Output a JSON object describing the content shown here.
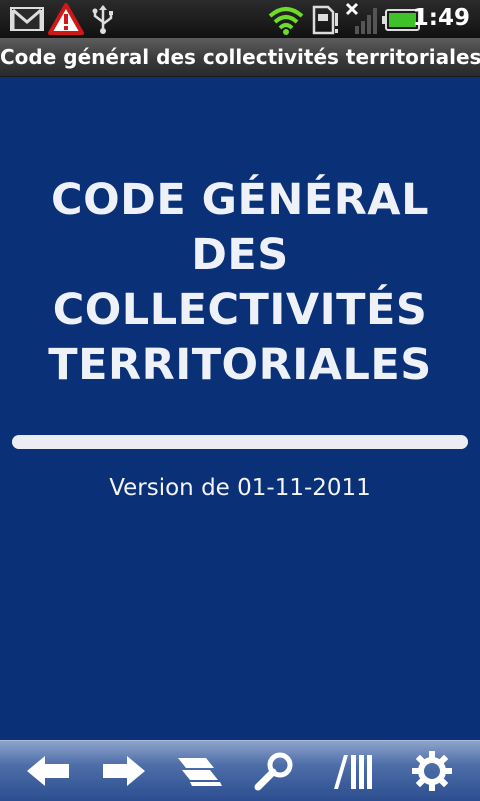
{
  "status_bar": {
    "time": "1:49",
    "icons": [
      "gmail-icon",
      "warning-icon",
      "usb-icon",
      "wifi-icon",
      "sim-card-icon",
      "signal-icon",
      "battery-icon"
    ]
  },
  "app": {
    "title": "Code général des collectivités territoriales"
  },
  "main": {
    "book_title_lines": [
      "CODE GÉNÉRAL DES",
      "COLLECTIVITÉS",
      "TERRITORIALES"
    ],
    "progress_fraction": 1.0,
    "version": "Version de 01-11-2011"
  },
  "toolbar": {
    "items": [
      "back-arrow-icon",
      "forward-arrow-icon",
      "table-of-contents-icon",
      "search-icon",
      "library-icon",
      "settings-icon"
    ]
  },
  "colors": {
    "background": "#0a3078",
    "title_text": "#eef2f8",
    "toolbar": "#4e6ea8"
  }
}
